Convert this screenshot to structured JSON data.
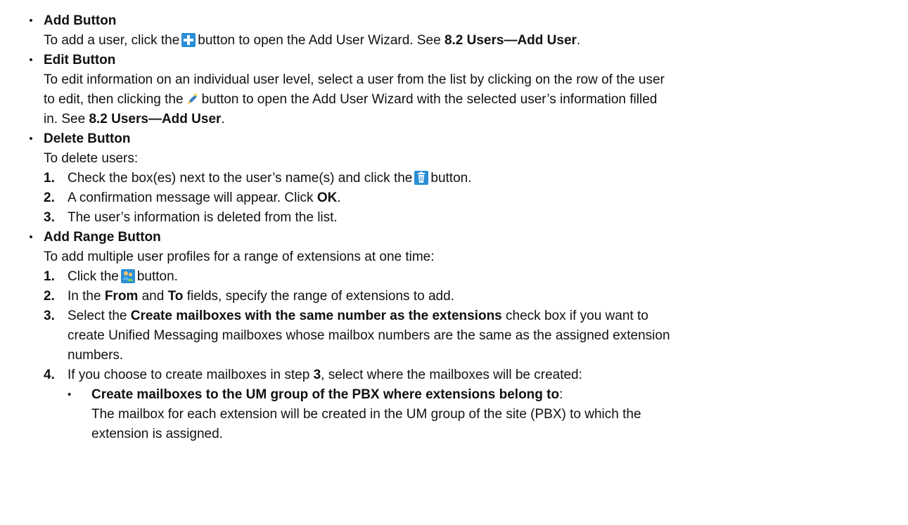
{
  "sections": {
    "add": {
      "title": "Add Button",
      "text_before": "To add a user, click the",
      "text_after": "button to open the Add User Wizard. See",
      "ref": "8.2  Users—Add User",
      "end": "."
    },
    "edit": {
      "title": "Edit Button",
      "line1": "To edit information on an individual user level, select a user from the list by clicking on the row of the user",
      "line2_before": "to edit, then clicking the",
      "line2_after": "button to open the Add User Wizard with the selected user’s information filled",
      "line3_before": "in. See",
      "ref": "8.2  Users—Add User",
      "end": "."
    },
    "delete": {
      "title": "Delete Button",
      "intro": "To delete users:",
      "step1_num": "1.",
      "step1_before": "Check the box(es) next to the user’s name(s) and click the",
      "step1_after": "button.",
      "step2_num": "2.",
      "step2_before": "A confirmation message will appear. Click",
      "step2_bold": "OK",
      "step2_end": ".",
      "step3_num": "3.",
      "step3_text": "The user’s information is deleted from the list."
    },
    "range": {
      "title": "Add Range Button",
      "intro": "To add multiple user profiles for a range of extensions at one time:",
      "step1_num": "1.",
      "step1_before": "Click the",
      "step1_after": "button.",
      "step2_num": "2.",
      "step2_a": "In the",
      "step2_from": "From",
      "step2_b": "and",
      "step2_to": "To",
      "step2_c": "fields, specify the range of extensions to add.",
      "step3_num": "3.",
      "step3_a": "Select the",
      "step3_bold": "Create mailboxes with the same number as the extensions",
      "step3_b": "check box if you want to",
      "step3_line2": "create Unified Messaging mailboxes whose mailbox numbers are the same as the assigned extension",
      "step3_line3": "numbers.",
      "step4_num": "4.",
      "step4_a": "If you choose to create mailboxes in step",
      "step4_bold": "3",
      "step4_b": ", select where the mailboxes will be created:",
      "sub_title": "Create mailboxes to the UM group of the PBX where extensions belong to",
      "sub_colon": ":",
      "sub_line1": "The mailbox for each extension will be created in the UM group of the site (PBX) to which the",
      "sub_line2": "extension is assigned."
    }
  },
  "icons": {
    "add": "plus-icon",
    "edit": "pencil-icon",
    "delete": "trash-icon",
    "range": "users-icon"
  },
  "colors": {
    "icon_blue": "#2a8fd6"
  }
}
